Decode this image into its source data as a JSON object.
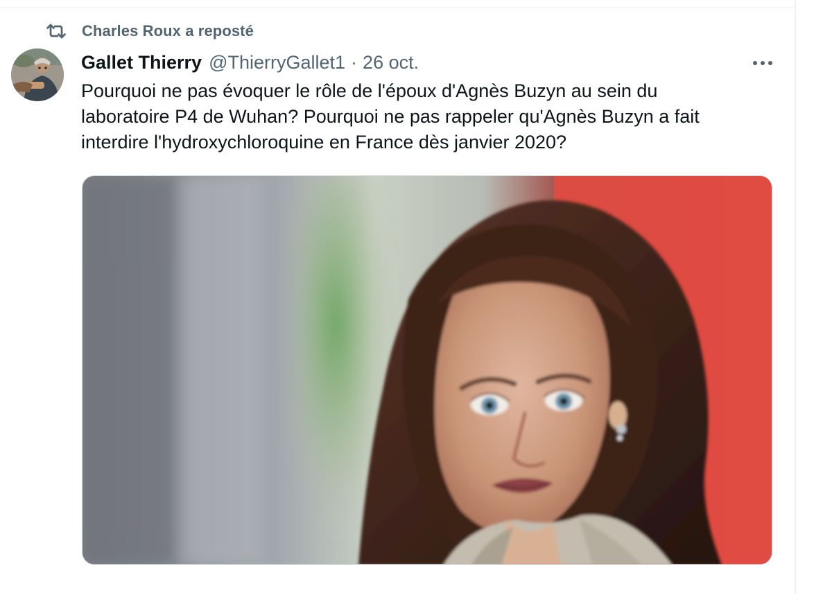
{
  "repost": {
    "icon": "repost-icon",
    "label": "Charles Roux a reposté"
  },
  "tweet": {
    "author": {
      "name": "Gallet Thierry",
      "handle": "@ThierryGallet1",
      "avatar_icon": "avatar"
    },
    "separator": "·",
    "date": "26 oct.",
    "more_icon": "more-options-icon",
    "text": "Pourquoi ne pas évoquer le rôle de l'époux d'Agnès Buzyn au sein du\nlaboratoire P4 de Wuhan? Pourquoi ne pas rappeler qu'Agnès Buzyn a fait\ninterdire l'hydroxychloroquine en France dès janvier 2020?",
    "media": {
      "type": "photo",
      "colors": {
        "background_left": "#8d9096",
        "background_right": "#e14b42",
        "hair": "#3b2219",
        "skin": "#c99577",
        "jacket": "#c4bcae"
      }
    }
  },
  "colors": {
    "primary_text": "#0f1419",
    "secondary_text": "#536471",
    "divider": "#eff3f4"
  }
}
